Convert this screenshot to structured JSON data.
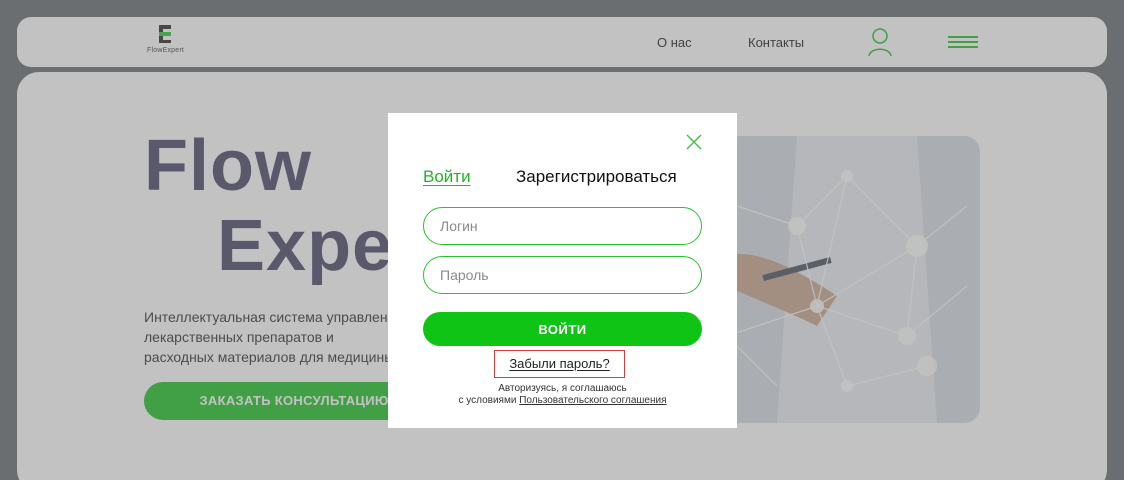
{
  "header": {
    "logo_text": "FlowExpert",
    "nav": {
      "about": "О нас",
      "contacts": "Контакты"
    },
    "accent_color": "#27c22e"
  },
  "hero": {
    "title_line1": "Flow",
    "title_line2": "Expe",
    "description": "Интеллектуальная система управления лекарственных препаратов и расходных материалов для медицины",
    "cta_label": "ЗАКАЗАТЬ КОНСУЛЬТАЦИЮ"
  },
  "modal": {
    "tab_login": "Войти",
    "tab_register": "Зарегистрироваться",
    "login_placeholder": "Логин",
    "password_placeholder": "Пароль",
    "submit_label": "ВОЙТИ",
    "forgot_label": "Забыли пароль?",
    "terms_line1": "Авторизуясь, я соглашаюсь",
    "terms_prefix": "с условиями",
    "terms_link": "Пользовательского соглашения",
    "primary_color": "#0fc414",
    "highlight_color": "#d63a3a"
  }
}
